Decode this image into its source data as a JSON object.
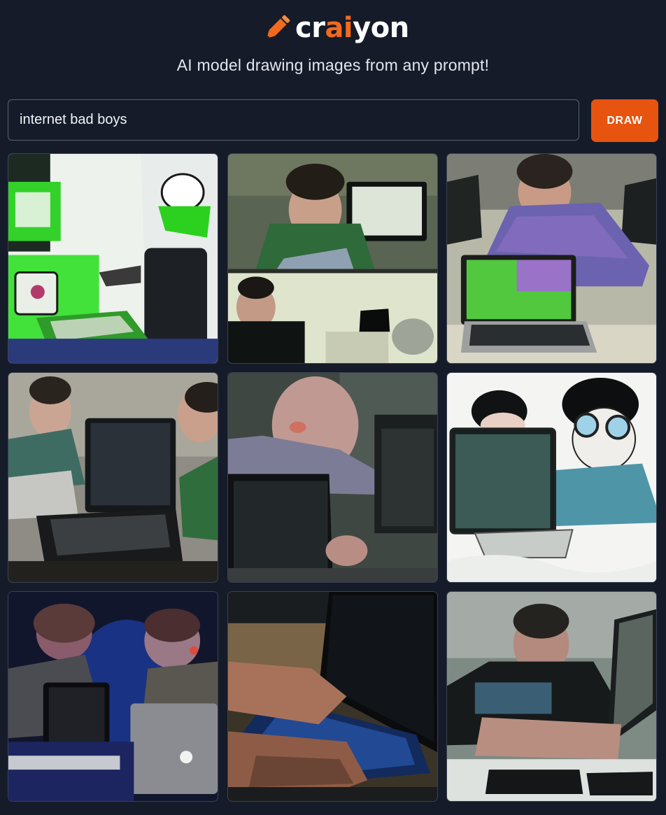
{
  "header": {
    "logo_icon": "pencil-icon",
    "logo_text_start": "cr",
    "logo_text_accent": "ai",
    "logo_text_end": "yon",
    "tagline": "AI model drawing images from any prompt!"
  },
  "prompt": {
    "value": "internet bad boys"
  },
  "draw_button": {
    "label": "DRAW"
  },
  "colors": {
    "background": "#151b29",
    "accent": "#e65410",
    "logo_accent": "#f26a1c"
  },
  "results": [
    {
      "subject": "green cartoon computer illustration"
    },
    {
      "subject": "two photos of boys at monitors"
    },
    {
      "subject": "boy in patterned sweater behind laptop"
    },
    {
      "subject": "two boys with laptops in dim room"
    },
    {
      "subject": "close-up of boy behind laptop"
    },
    {
      "subject": "cartoon boy with glasses behind laptop"
    },
    {
      "subject": "two boys with glowing laptops"
    },
    {
      "subject": "hands typing on backlit keyboard"
    },
    {
      "subject": "boy in black t-shirt typing on laptop"
    }
  ]
}
